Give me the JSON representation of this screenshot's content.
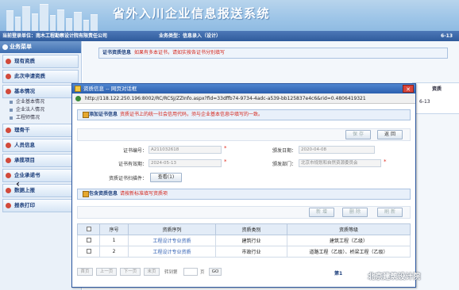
{
  "app": {
    "title": "省外入川企业信息报送系统",
    "user_info": "当前登录单位：南木工程勘察设计院有限责任公司",
    "business_type": "业务类型：信息录入（设计）",
    "bg_date_partial": "6-13"
  },
  "sidebar": {
    "menu_title": "业务菜单",
    "items": [
      {
        "label": "现有资质"
      },
      {
        "label": "此次申请资质"
      },
      {
        "label": "基本情况"
      },
      {
        "label": "理骨干"
      },
      {
        "label": "人员信息"
      },
      {
        "label": "承揽项目"
      },
      {
        "label": "企业承诺书"
      },
      {
        "label": "数据上报"
      },
      {
        "label": "报表打印"
      }
    ],
    "sub_items": [
      {
        "label": "企业基本情况"
      },
      {
        "label": "企业法人情况"
      },
      {
        "label": "工程师情况"
      }
    ]
  },
  "main": {
    "cert_section_title": "证书资质信息",
    "cert_section_note": "如果有多本证书，请如实按各证书分别填写",
    "bg_column_partial": "资质"
  },
  "dialog": {
    "title": "资质信息 -- 网页对话框",
    "url": "http://118.122.250.196:8002/RC/RCSJ/ZZInfo.aspx?fid=33dffb74-9734-4adc-a539-bb125837e4c6&rid=0.4806419321",
    "add_section_title": "添加证书信息",
    "add_section_note": "资质证书上的统一社会信用代码，须与企业基本信息中填写的一致。",
    "save_label": "保 存",
    "back_label": "返 回",
    "form": {
      "cert_no_label": "证书编号：",
      "cert_no_value": "A211032618",
      "issue_date_label": "颁发日期：",
      "issue_date_value": "2020-04-08",
      "valid_until_label": "证书有效期：",
      "valid_until_value": "2024-05-13",
      "issuer_label": "颁发部门：",
      "issuer_value": "北京市规划和自然资源委员会",
      "scan_label": "资质证书扫描件：",
      "view_button": "查看(1)"
    },
    "qual_section_title": "包含资质信息",
    "qual_section_note": "请按新标准填写资质项",
    "add_label": "新 增",
    "delete_label": "删 除",
    "refresh_label": "刷 新",
    "table": {
      "headers": [
        "",
        "序号",
        "资质序列",
        "资质类别",
        "资质等级"
      ],
      "rows": [
        {
          "no": "1",
          "sequence": "工程设计专业资质",
          "category": "建筑行业",
          "grade": "建筑工程（乙级）"
        },
        {
          "no": "2",
          "sequence": "工程设计专业资质",
          "category": "市政行业",
          "grade": "道路工程（乙级）、桥梁工程（乙级）"
        }
      ]
    },
    "pager": {
      "first": "首页",
      "prev": "上一页",
      "next": "下一页",
      "last": "末页",
      "goto_label": "转到第",
      "page_unit": "页",
      "go": "GO",
      "right_partial": "第1"
    }
  },
  "watermark": "北京建筑设计院"
}
